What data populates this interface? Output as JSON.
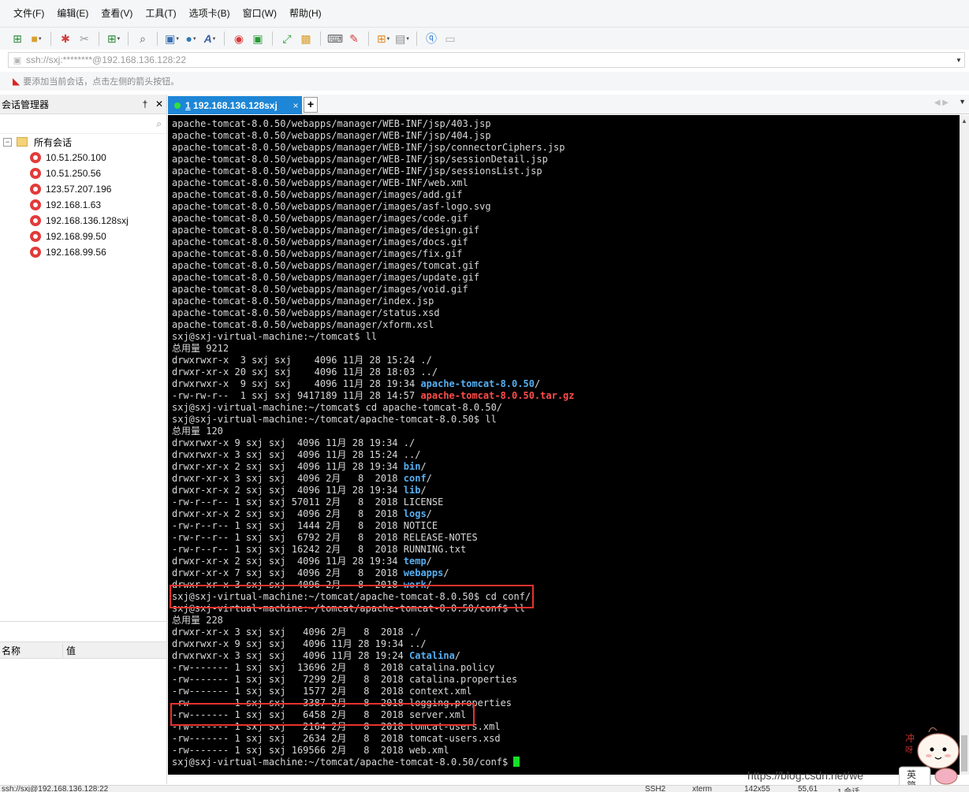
{
  "menu": [
    "文件(F)",
    "编辑(E)",
    "查看(V)",
    "工具(T)",
    "选项卡(B)",
    "窗口(W)",
    "帮助(H)"
  ],
  "address_bar": {
    "value": "ssh://sxj:********@192.168.136.128:22"
  },
  "hint": "要添加当前会话，点击左侧的箭头按钮。",
  "session_manager": {
    "title": "会话管理器",
    "root_label": "所有会话",
    "sessions": [
      "10.51.250.100",
      "10.51.250.56",
      "123.57.207.196",
      "192.168.1.63",
      "192.168.136.128sxj",
      "192.168.99.50",
      "192.168.99.56"
    ]
  },
  "properties": {
    "col_name": "名称",
    "col_value": "值"
  },
  "tab": {
    "number": "1",
    "label": "192.168.136.128sxj",
    "close": "×",
    "add": "+"
  },
  "terminal": {
    "lines": [
      [
        [
          "apache-tomcat-8.0.50/webapps/manager/WEB-INF/jsp/403.jsp",
          "n"
        ]
      ],
      [
        [
          "apache-tomcat-8.0.50/webapps/manager/WEB-INF/jsp/404.jsp",
          "n"
        ]
      ],
      [
        [
          "apache-tomcat-8.0.50/webapps/manager/WEB-INF/jsp/connectorCiphers.jsp",
          "n"
        ]
      ],
      [
        [
          "apache-tomcat-8.0.50/webapps/manager/WEB-INF/jsp/sessionDetail.jsp",
          "n"
        ]
      ],
      [
        [
          "apache-tomcat-8.0.50/webapps/manager/WEB-INF/jsp/sessionsList.jsp",
          "n"
        ]
      ],
      [
        [
          "apache-tomcat-8.0.50/webapps/manager/WEB-INF/web.xml",
          "n"
        ]
      ],
      [
        [
          "apache-tomcat-8.0.50/webapps/manager/images/add.gif",
          "n"
        ]
      ],
      [
        [
          "apache-tomcat-8.0.50/webapps/manager/images/asf-logo.svg",
          "n"
        ]
      ],
      [
        [
          "apache-tomcat-8.0.50/webapps/manager/images/code.gif",
          "n"
        ]
      ],
      [
        [
          "apache-tomcat-8.0.50/webapps/manager/images/design.gif",
          "n"
        ]
      ],
      [
        [
          "apache-tomcat-8.0.50/webapps/manager/images/docs.gif",
          "n"
        ]
      ],
      [
        [
          "apache-tomcat-8.0.50/webapps/manager/images/fix.gif",
          "n"
        ]
      ],
      [
        [
          "apache-tomcat-8.0.50/webapps/manager/images/tomcat.gif",
          "n"
        ]
      ],
      [
        [
          "apache-tomcat-8.0.50/webapps/manager/images/update.gif",
          "n"
        ]
      ],
      [
        [
          "apache-tomcat-8.0.50/webapps/manager/images/void.gif",
          "n"
        ]
      ],
      [
        [
          "apache-tomcat-8.0.50/webapps/manager/index.jsp",
          "n"
        ]
      ],
      [
        [
          "apache-tomcat-8.0.50/webapps/manager/status.xsd",
          "n"
        ]
      ],
      [
        [
          "apache-tomcat-8.0.50/webapps/manager/xform.xsl",
          "n"
        ]
      ],
      [
        [
          "sxj@sxj-virtual-machine:~/tomcat$ ll",
          "n"
        ]
      ],
      [
        [
          "总用量 9212",
          "n"
        ]
      ],
      [
        [
          "drwxrwxr-x  3 sxj sxj    4096 11月 28 15:24 ./",
          "n"
        ]
      ],
      [
        [
          "drwxr-xr-x 20 sxj sxj    4096 11月 28 18:03 ../",
          "n"
        ]
      ],
      [
        [
          "drwxrwxr-x  9 sxj sxj    4096 11月 28 19:34 ",
          "n"
        ],
        [
          "apache-tomcat-8.0.50",
          "blue"
        ],
        [
          "/",
          "n"
        ]
      ],
      [
        [
          "-rw-rw-r--  1 sxj sxj 9417189 11月 28 14:57 ",
          "n"
        ],
        [
          "apache-tomcat-8.0.50.tar.gz",
          "red"
        ]
      ],
      [
        [
          "sxj@sxj-virtual-machine:~/tomcat$ cd apache-tomcat-8.0.50/",
          "n"
        ]
      ],
      [
        [
          "sxj@sxj-virtual-machine:~/tomcat/apache-tomcat-8.0.50$ ll",
          "n"
        ]
      ],
      [
        [
          "总用量 120",
          "n"
        ]
      ],
      [
        [
          "drwxrwxr-x 9 sxj sxj  4096 11月 28 19:34 ./",
          "n"
        ]
      ],
      [
        [
          "drwxrwxr-x 3 sxj sxj  4096 11月 28 15:24 ../",
          "n"
        ]
      ],
      [
        [
          "drwxr-xr-x 2 sxj sxj  4096 11月 28 19:34 ",
          "n"
        ],
        [
          "bin",
          "blue"
        ],
        [
          "/",
          "n"
        ]
      ],
      [
        [
          "drwxr-xr-x 3 sxj sxj  4096 2月   8  2018 ",
          "n"
        ],
        [
          "conf",
          "blue"
        ],
        [
          "/",
          "n"
        ]
      ],
      [
        [
          "drwxr-xr-x 2 sxj sxj  4096 11月 28 19:34 ",
          "n"
        ],
        [
          "lib",
          "blue"
        ],
        [
          "/",
          "n"
        ]
      ],
      [
        [
          "-rw-r--r-- 1 sxj sxj 57011 2月   8  2018 LICENSE",
          "n"
        ]
      ],
      [
        [
          "drwxr-xr-x 2 sxj sxj  4096 2月   8  2018 ",
          "n"
        ],
        [
          "logs",
          "blue"
        ],
        [
          "/",
          "n"
        ]
      ],
      [
        [
          "-rw-r--r-- 1 sxj sxj  1444 2月   8  2018 NOTICE",
          "n"
        ]
      ],
      [
        [
          "-rw-r--r-- 1 sxj sxj  6792 2月   8  2018 RELEASE-NOTES",
          "n"
        ]
      ],
      [
        [
          "-rw-r--r-- 1 sxj sxj 16242 2月   8  2018 RUNNING.txt",
          "n"
        ]
      ],
      [
        [
          "drwxr-xr-x 2 sxj sxj  4096 11月 28 19:34 ",
          "n"
        ],
        [
          "temp",
          "blue"
        ],
        [
          "/",
          "n"
        ]
      ],
      [
        [
          "drwxr-xr-x 7 sxj sxj  4096 2月   8  2018 ",
          "n"
        ],
        [
          "webapps",
          "blue"
        ],
        [
          "/",
          "n"
        ]
      ],
      [
        [
          "drwxr-xr-x 3 sxj sxj  4096 2月   8  2018 ",
          "n"
        ],
        [
          "work",
          "blue"
        ],
        [
          "/",
          "n"
        ]
      ],
      [
        [
          "sxj@sxj-virtual-machine:~/tomcat/apache-tomcat-8.0.50$ cd conf/",
          "n"
        ]
      ],
      [
        [
          "sxj@sxj-virtual-machine:~/tomcat/apache-tomcat-8.0.50/conf$ ll",
          "n"
        ]
      ],
      [
        [
          "总用量 228",
          "n"
        ]
      ],
      [
        [
          "drwxr-xr-x 3 sxj sxj   4096 2月   8  2018 ./",
          "n"
        ]
      ],
      [
        [
          "drwxrwxr-x 9 sxj sxj   4096 11月 28 19:34 ../",
          "n"
        ]
      ],
      [
        [
          "drwxrwxr-x 3 sxj sxj   4096 11月 28 19:24 ",
          "n"
        ],
        [
          "Catalina",
          "blue"
        ],
        [
          "/",
          "n"
        ]
      ],
      [
        [
          "-rw------- 1 sxj sxj  13696 2月   8  2018 catalina.policy",
          "n"
        ]
      ],
      [
        [
          "-rw------- 1 sxj sxj   7299 2月   8  2018 catalina.properties",
          "n"
        ]
      ],
      [
        [
          "-rw------- 1 sxj sxj   1577 2月   8  2018 context.xml",
          "n"
        ]
      ],
      [
        [
          "-rw------- 1 sxj sxj   3387 2月   8  2018 logging.properties",
          "n"
        ]
      ],
      [
        [
          "-rw------- 1 sxj sxj   6458 2月   8  2018 server.xml",
          "n"
        ]
      ],
      [
        [
          "-rw------- 1 sxj sxj   2164 2月   8  2018 tomcat-users.xml",
          "n"
        ]
      ],
      [
        [
          "-rw------- 1 sxj sxj   2634 2月   8  2018 tomcat-users.xsd",
          "n"
        ]
      ],
      [
        [
          "-rw------- 1 sxj sxj 169566 2月   8  2018 web.xml",
          "n"
        ]
      ],
      [
        [
          "sxj@sxj-virtual-machine:~/tomcat/apache-tomcat-8.0.50/conf$ ",
          "n"
        ]
      ]
    ]
  },
  "watermark": "https://blog.csdn.net/we",
  "sticker_text": [
    "冲",
    "呀",
    "英",
    "简"
  ],
  "status_bar": {
    "connection": "ssh://sxj@192.168.136.128:22",
    "protocol": "SSH2",
    "terminal_type": "xterm",
    "size": "142x55",
    "position": "55,61",
    "sessions": "1 会话"
  },
  "colors": {
    "tab_active": "#1e86d6",
    "terminal_bg": "#000000",
    "dir_blue": "#56aff2",
    "archive_red": "#ff4c4c",
    "cursor_green": "#15e029",
    "highlight_box": "#e8322d"
  }
}
